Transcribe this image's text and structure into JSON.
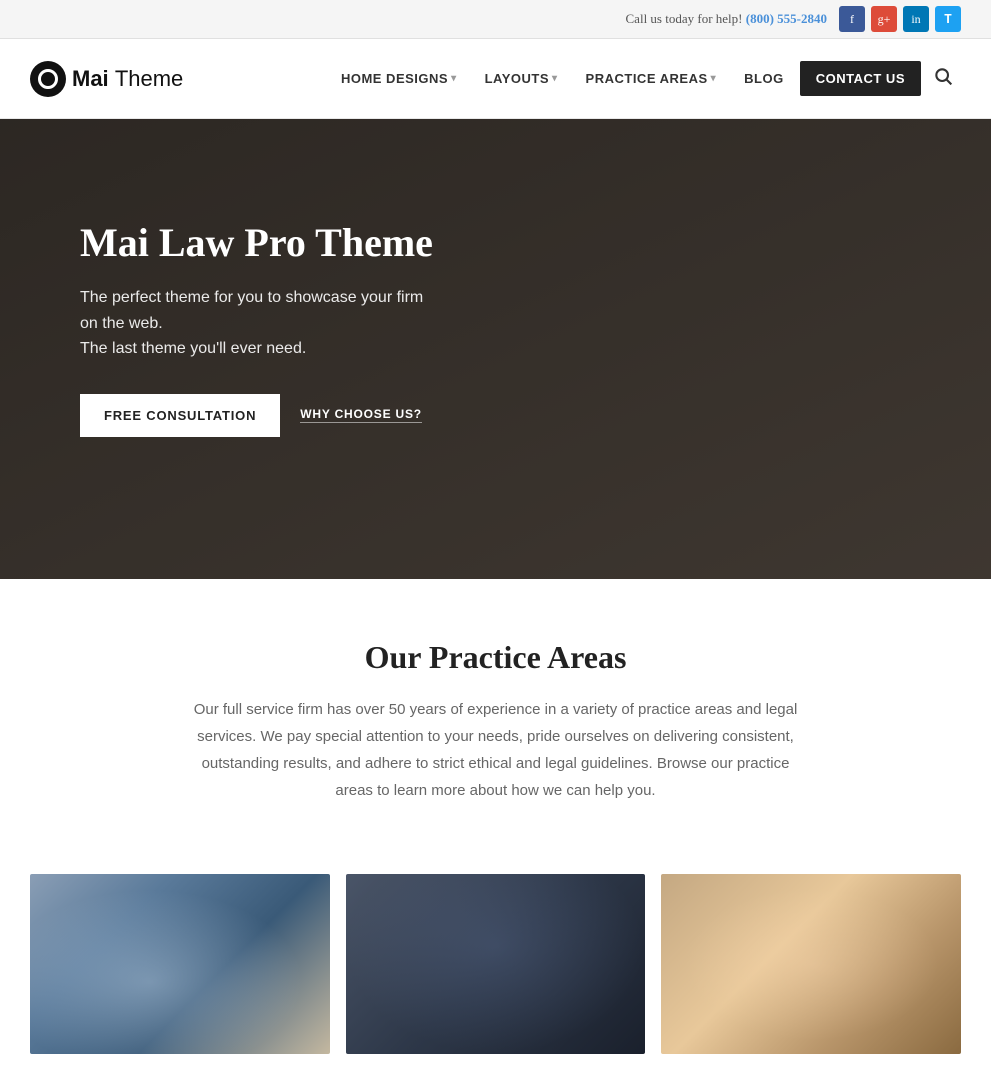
{
  "topbar": {
    "helptext": "Call us today for help!",
    "phone": "(800) 555-2840",
    "socials": [
      {
        "name": "Facebook",
        "short": "f",
        "type": "fb"
      },
      {
        "name": "Google Plus",
        "short": "g+",
        "type": "gp"
      },
      {
        "name": "LinkedIn",
        "short": "in",
        "type": "li"
      },
      {
        "name": "Twitter",
        "short": "t",
        "type": "tw"
      }
    ]
  },
  "header": {
    "logo_brand": "Mai",
    "logo_suffix": "Theme",
    "nav": [
      {
        "label": "HOME DESIGNS",
        "hasDropdown": true
      },
      {
        "label": "LAYOUTS",
        "hasDropdown": true
      },
      {
        "label": "PRACTICE AREAS",
        "hasDropdown": true
      },
      {
        "label": "BLOG",
        "hasDropdown": false
      },
      {
        "label": "CONTACT US",
        "isButton": true
      }
    ],
    "search_label": "Search"
  },
  "hero": {
    "title": "Mai Law Pro Theme",
    "subtitle_line1": "The perfect theme for you to showcase your firm on the web.",
    "subtitle_line2": "The last theme you'll ever need.",
    "cta_primary": "FREE CONSULTATION",
    "cta_secondary": "WHY CHOOSE US?"
  },
  "practice": {
    "title": "Our Practice Areas",
    "description": "Our full service firm has over 50 years of experience in a variety of practice areas and legal services. We pay special attention to your needs, pride ourselves on delivering consistent, outstanding results, and adhere to strict ethical and legal guidelines. Browse our practice areas to learn more about how we can help you."
  },
  "cards": [
    {
      "id": "card-1",
      "alt": "Legal documents on desk"
    },
    {
      "id": "card-2",
      "alt": "Law office interior"
    },
    {
      "id": "card-3",
      "alt": "Legal scales and books"
    }
  ]
}
